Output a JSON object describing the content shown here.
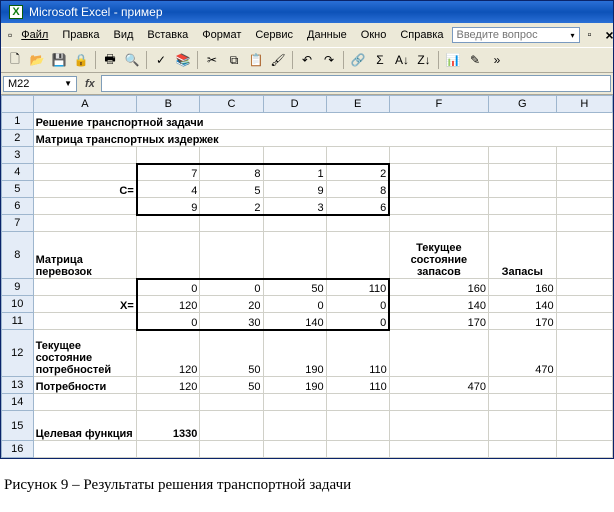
{
  "window": {
    "app": "Microsoft Excel",
    "doc": "пример"
  },
  "menu": {
    "file": "Файл",
    "edit": "Правка",
    "view": "Вид",
    "insert": "Вставка",
    "format": "Формат",
    "tools": "Сервис",
    "data": "Данные",
    "window": "Окно",
    "help": "Справка",
    "help_ph": "Введите вопрос"
  },
  "namebox": "M22",
  "cols": [
    "A",
    "B",
    "C",
    "D",
    "E",
    "F",
    "G",
    "H"
  ],
  "labels": {
    "r1": "Решение транспортной задачи",
    "r2": "Матрица транспортных издержек",
    "c_eq": "C=",
    "r8a": "Матрица перевозок",
    "r8f": "Текущее состояние запасов",
    "r8g": "Запасы",
    "x_eq": "X=",
    "r12a": "Текущее состояние потребностей",
    "r13a": "Потребности",
    "r15a": "Целевая функция"
  },
  "C": [
    [
      7,
      8,
      1,
      2
    ],
    [
      4,
      5,
      9,
      8
    ],
    [
      9,
      2,
      3,
      6
    ]
  ],
  "X": [
    [
      0,
      0,
      50,
      110
    ],
    [
      120,
      20,
      0,
      0
    ],
    [
      0,
      30,
      140,
      0
    ]
  ],
  "stock_cur": [
    160,
    140,
    170
  ],
  "stock": [
    160,
    140,
    170
  ],
  "need_cur": [
    120,
    50,
    190,
    110
  ],
  "need": [
    120,
    50,
    190,
    110
  ],
  "need_cur_total": 470,
  "need_f": 470,
  "obj": 1330,
  "caption": "Рисунок 9 – Результаты решения транспортной задачи",
  "chart_data": {
    "type": "table",
    "title": "Решение транспортной задачи",
    "cost_matrix": [
      [
        7,
        8,
        1,
        2
      ],
      [
        4,
        5,
        9,
        8
      ],
      [
        9,
        2,
        3,
        6
      ]
    ],
    "shipment_matrix": [
      [
        0,
        0,
        50,
        110
      ],
      [
        120,
        20,
        0,
        0
      ],
      [
        0,
        30,
        140,
        0
      ]
    ],
    "supply": [
      160,
      140,
      170
    ],
    "demand": [
      120,
      50,
      190,
      110
    ],
    "objective": 1330
  }
}
